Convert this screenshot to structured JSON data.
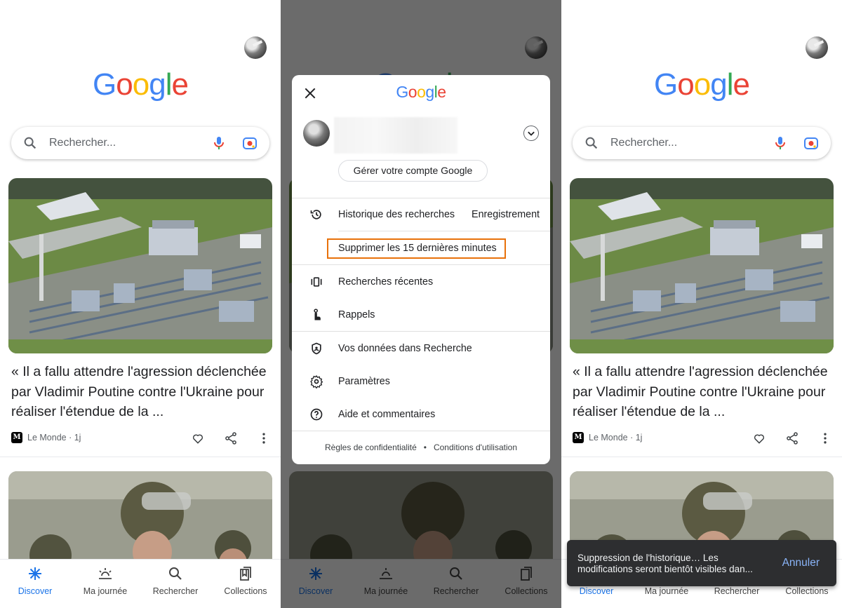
{
  "brand": {
    "logo_letters": [
      "G",
      "o",
      "o",
      "g",
      "l",
      "e"
    ]
  },
  "colors": {
    "google_blue": "#4285f4",
    "google_red": "#ea4335",
    "google_yellow": "#fbbc05",
    "google_green": "#34a853",
    "active_tab": "#1a73e8",
    "highlight_border": "#e8710a",
    "snackbar_bg": "#2d2e30",
    "snackbar_action": "#8ab4f8"
  },
  "search": {
    "placeholder": "Rechercher..."
  },
  "feed": {
    "card1": {
      "title": "« Il a fallu attendre l'agression déclenchée par Vladimir Poutine contre l'Ukraine pour réaliser l'étendue de la ...",
      "source_logo": "M",
      "source": "Le Monde · 1j"
    }
  },
  "nav": [
    {
      "label": "Discover",
      "icon": "discover-icon",
      "active": true
    },
    {
      "label": "Ma journée",
      "icon": "my-day-icon",
      "active": false
    },
    {
      "label": "Rechercher",
      "icon": "search-icon",
      "active": false
    },
    {
      "label": "Collections",
      "icon": "collections-icon",
      "active": false
    }
  ],
  "account_menu": {
    "manage_account": "Gérer votre compte Google",
    "items": [
      {
        "label": "Historique des recherches",
        "right": "Enregistrement",
        "icon": "history-icon"
      },
      {
        "label": "Supprimer les 15 dernières minutes",
        "icon": "none"
      },
      {
        "label": "Recherches récentes",
        "icon": "recent-searches-icon"
      },
      {
        "label": "Rappels",
        "icon": "reminder-icon"
      },
      {
        "label": "Vos données dans Recherche",
        "icon": "shield-icon"
      },
      {
        "label": "Paramètres",
        "icon": "gear-icon"
      },
      {
        "label": "Aide et commentaires",
        "icon": "help-icon"
      }
    ],
    "footer": {
      "privacy": "Règles de confidentialité",
      "separator": "•",
      "terms": "Conditions d'utilisation"
    }
  },
  "snackbar": {
    "message": "Suppression de l'historique… Les modifications seront bientôt visibles dan...",
    "action": "Annuler"
  }
}
